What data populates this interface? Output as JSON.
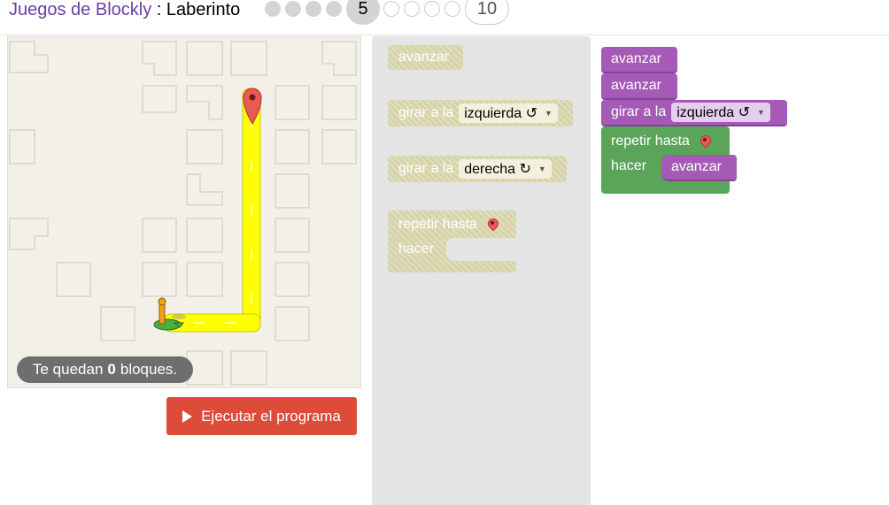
{
  "header": {
    "app_name": "Juegos de Blockly",
    "separator": " : ",
    "game_name": "Laberinto",
    "levels_done": [
      1,
      2,
      3,
      4
    ],
    "current_level": "5",
    "levels_todo": [
      6,
      7,
      8,
      9
    ],
    "last_level": "10"
  },
  "maze": {
    "capacity_prefix": "Te quedan",
    "capacity_count": "0",
    "capacity_suffix": "bloques."
  },
  "run_button": {
    "label": "Ejecutar el programa"
  },
  "toolbox": {
    "move_forward": "avanzar",
    "turn_left_prefix": "girar a la",
    "turn_left_value": "izquierda ↺",
    "turn_right_prefix": "girar a la",
    "turn_right_value": "derecha ↻",
    "repeat_label": "repetir hasta",
    "do_label": "hacer"
  },
  "workspace": {
    "block1": "avanzar",
    "block2": "avanzar",
    "block3_prefix": "girar a la",
    "block3_value": "izquierda ↺",
    "repeat_label": "repetir hasta",
    "do_label": "hacer",
    "inner_block": "avanzar"
  },
  "colors": {
    "header_accent": "#6b3fa3",
    "run_button": "#dd4b39",
    "movement_block": "#a55bb5",
    "loop_block": "#5ba55b",
    "path": "#ffff00"
  },
  "icons": [
    "marker-icon",
    "pegman-icon",
    "play-icon",
    "dropdown-caret-icon"
  ]
}
